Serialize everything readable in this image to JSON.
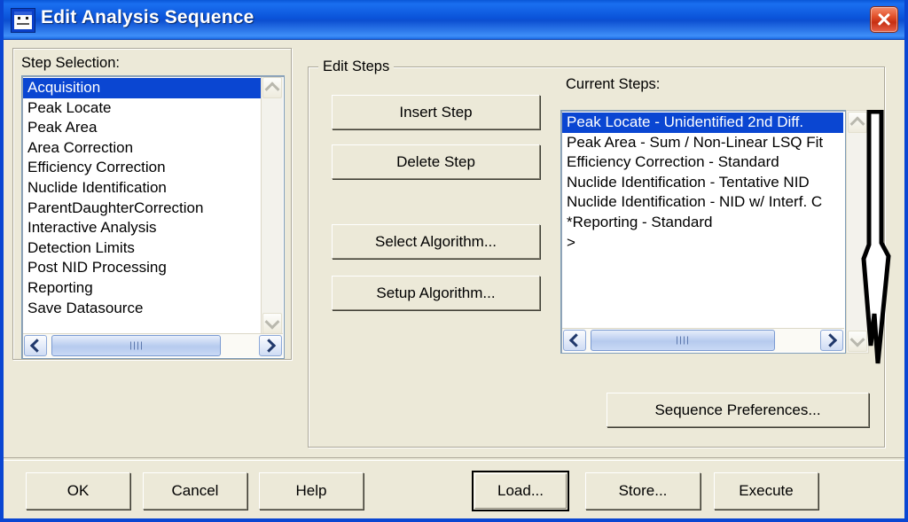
{
  "window": {
    "title": "Edit Analysis Sequence",
    "icon": "analysis-window-icon",
    "close_label": "×",
    "titlebar_color": "#0a52d8",
    "close_color": "#c62f12",
    "dialog_background": "#ece9d8"
  },
  "step_selection": {
    "label": "Step Selection:",
    "selected_index": 0,
    "items": [
      "Acquisition",
      "Peak Locate",
      "Peak Area",
      "Area Correction",
      "Efficiency Correction",
      "Nuclide Identification",
      "ParentDaughterCorrection",
      "Interactive Analysis",
      "Detection Limits",
      "Post NID Processing",
      "Reporting",
      "Save Datasource"
    ],
    "vscroll": {
      "up": "scroll-up-icon",
      "down": "scroll-down-icon",
      "enabled": false
    },
    "hscroll": {
      "left": "scroll-left-icon",
      "right": "scroll-right-icon",
      "enabled": true
    }
  },
  "edit_steps": {
    "group_title": "Edit Steps",
    "buttons": [
      {
        "name": "insert-step",
        "label": "Insert Step"
      },
      {
        "name": "delete-step",
        "label": "Delete Step"
      },
      {
        "name": "select-algorithm",
        "label": "Select Algorithm..."
      },
      {
        "name": "setup-algorithm",
        "label": "Setup Algorithm..."
      }
    ],
    "sequence_preferences_label": "Sequence Preferences..."
  },
  "current_steps": {
    "label": "Current Steps:",
    "selected_index": 0,
    "items": [
      "Peak Locate - Unidentified 2nd Diff.",
      "Peak Area - Sum / Non-Linear LSQ Fit",
      "Efficiency Correction - Standard",
      "Nuclide Identification - Tentative NID",
      "Nuclide Identification - NID w/ Interf. C",
      "*Reporting - Standard",
      ">"
    ],
    "vscroll": {
      "up": "scroll-up-icon",
      "down": "scroll-down-icon",
      "enabled": false
    },
    "hscroll": {
      "left": "scroll-left-icon",
      "right": "scroll-right-icon",
      "enabled": true
    }
  },
  "footer": {
    "buttons": [
      {
        "name": "ok",
        "label": "OK",
        "default": false
      },
      {
        "name": "cancel",
        "label": "Cancel",
        "default": false
      },
      {
        "name": "help",
        "label": "Help",
        "default": false
      },
      {
        "name": "load",
        "label": "Load...",
        "default": true
      },
      {
        "name": "store",
        "label": "Store...",
        "default": false
      },
      {
        "name": "execute",
        "label": "Execute",
        "default": false
      }
    ]
  },
  "cursor": {
    "type": "arrow-pointer-stretched"
  }
}
